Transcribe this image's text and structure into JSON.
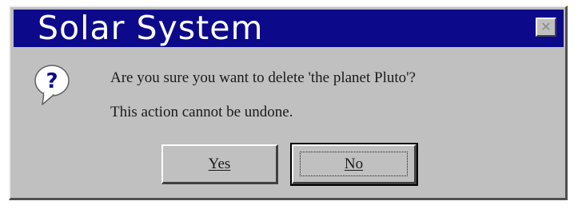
{
  "dialog": {
    "title": "Solar System",
    "close_icon": "close-icon",
    "question_icon": "question-icon",
    "message_line1": "Are you sure you want to delete 'the planet Pluto'?",
    "message_line2": "This action cannot be undone.",
    "yes_label": "Yes",
    "no_label": "No"
  },
  "colors": {
    "titlebar": "#0c0a8a",
    "dialog_bg": "#c0c0c0",
    "title_text": "#ffffff"
  }
}
